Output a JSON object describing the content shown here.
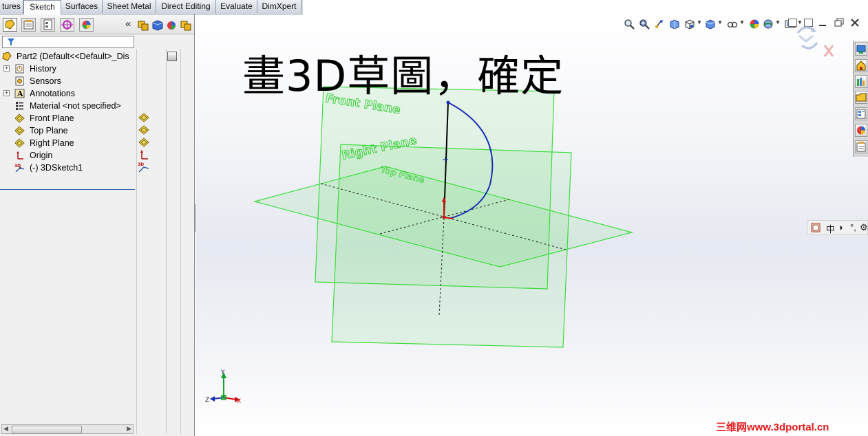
{
  "command_tabs": [
    {
      "label": "tures",
      "active": false
    },
    {
      "label": "Sketch",
      "active": true
    },
    {
      "label": "Surfaces",
      "active": false
    },
    {
      "label": "Sheet Metal",
      "active": false
    },
    {
      "label": "Direct Editing",
      "active": false
    },
    {
      "label": "Evaluate",
      "active": false
    },
    {
      "label": "DimXpert",
      "active": false
    }
  ],
  "feature_manager": {
    "collapse_glyph": "«",
    "filter_icon": "filter-icon",
    "tree": [
      {
        "label": "Part2  (Default<<Default>_Dis",
        "icon": "part-icon",
        "expander": ""
      },
      {
        "label": "History",
        "icon": "history-icon",
        "expander": "+"
      },
      {
        "label": "Sensors",
        "icon": "sensors-icon",
        "expander": ""
      },
      {
        "label": "Annotations",
        "icon": "annotations-icon",
        "expander": "+"
      },
      {
        "label": "Material <not specified>",
        "icon": "material-icon",
        "expander": ""
      },
      {
        "label": "Front Plane",
        "icon": "plane-icon",
        "expander": ""
      },
      {
        "label": "Top Plane",
        "icon": "plane-icon",
        "expander": ""
      },
      {
        "label": "Right Plane",
        "icon": "plane-icon",
        "expander": ""
      },
      {
        "label": "Origin",
        "icon": "origin-icon",
        "expander": ""
      },
      {
        "label": "(-) 3DSketch1",
        "icon": "3dsketch-icon",
        "expander": ""
      }
    ]
  },
  "viewport": {
    "caption": "畫3D草圖，確定",
    "plane_labels": {
      "front": "Front Plane",
      "right": "Right Plane",
      "top": "Top Plane"
    },
    "triad": {
      "x": "X",
      "y": "Y",
      "z": "Z"
    },
    "colors": {
      "plane": "#3ddc3d",
      "sketch_arc": "#1a2fb5",
      "sketch_line": "#000000",
      "origin": "#d01010"
    },
    "watermark": "三维网www.3dportal.cn"
  },
  "ime_bar": {
    "items": [
      "中",
      "◗",
      "°,",
      "⚙"
    ]
  }
}
